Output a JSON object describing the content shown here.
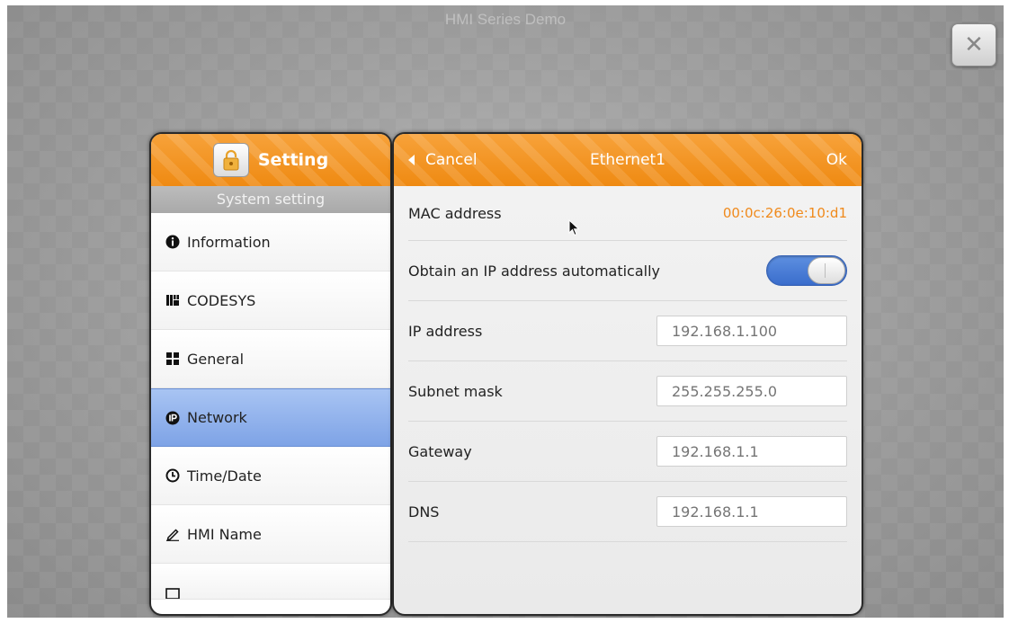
{
  "background": {
    "title": "HMI Series Demo"
  },
  "close_button": {
    "label": "✕"
  },
  "left_panel": {
    "title": "Setting",
    "subtitle": "System setting",
    "items": [
      {
        "label": "Information",
        "icon": "info-icon"
      },
      {
        "label": "CODESYS",
        "icon": "codesys-icon"
      },
      {
        "label": "General",
        "icon": "grid-icon"
      },
      {
        "label": "Network",
        "icon": "ip-icon",
        "active": true
      },
      {
        "label": "Time/Date",
        "icon": "clock-icon"
      },
      {
        "label": "HMI Name",
        "icon": "pen-icon"
      },
      {
        "label": "",
        "icon": "partial-icon"
      }
    ]
  },
  "right_panel": {
    "cancel_label": "Cancel",
    "title": "Ethernet1",
    "ok_label": "Ok",
    "mac_label": "MAC address",
    "mac_value": "00:0c:26:0e:10:d1",
    "dhcp_label": "Obtain an IP address automatically",
    "dhcp_on": true,
    "fields": [
      {
        "label": "IP address",
        "placeholder": "192.168.1.100"
      },
      {
        "label": "Subnet mask",
        "placeholder": "255.255.255.0"
      },
      {
        "label": "Gateway",
        "placeholder": "192.168.1.1"
      },
      {
        "label": "DNS",
        "placeholder": "192.168.1.1"
      }
    ]
  },
  "colors": {
    "accent_orange": "#ef8a12",
    "active_blue": "#7ea3e6",
    "toggle_blue": "#3a6dcc",
    "mac_orange": "#f08a1c"
  }
}
